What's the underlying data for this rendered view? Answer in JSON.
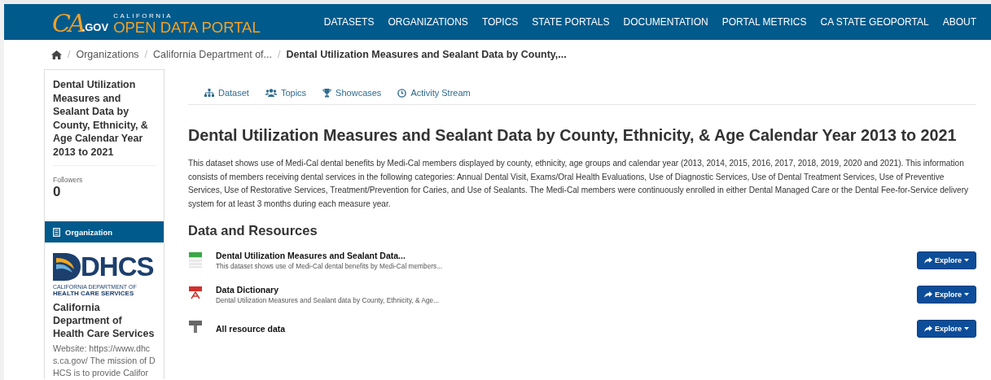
{
  "header": {
    "logo": {
      "mark": "CA",
      "gov": ".GOV",
      "top": "CALIFORNIA",
      "name": "OPEN DATA PORTAL"
    },
    "nav": [
      "DATASETS",
      "ORGANIZATIONS",
      "TOPICS",
      "STATE PORTALS",
      "DOCUMENTATION",
      "PORTAL METRICS",
      "CA STATE GEOPORTAL",
      "ABOUT"
    ]
  },
  "breadcrumb_separator": "/",
  "breadcrumb": [
    {
      "label": "Organizations",
      "current": false
    },
    {
      "label": "California Department of...",
      "current": false
    },
    {
      "label": "Dental Utilization Measures and Sealant Data by County,...",
      "current": true
    }
  ],
  "sidebar": {
    "title": "Dental Utilization Measures and Sealant Data by County, Ethnicity, & Age Calendar Year 2013 to 2021",
    "followers_label": "Followers",
    "followers": "0",
    "org_heading": "Organization",
    "org_logo": {
      "mark": "DHCS",
      "line1": "CALIFORNIA DEPARTMENT OF",
      "line2": "HEALTH CARE SERVICES"
    },
    "org_name": "California Department of Health Care Services",
    "org_text": "Website: https://www.dhcs.ca.gov/ The mission of DHCS is to provide Califor"
  },
  "tabs": [
    {
      "label": "Dataset",
      "kind": "sitemap"
    },
    {
      "label": "Topics",
      "kind": "users"
    },
    {
      "label": "Showcases",
      "kind": "trophy"
    },
    {
      "label": "Activity Stream",
      "kind": "clock"
    }
  ],
  "title": "Dental Utilization Measures and Sealant Data by County, Ethnicity, & Age Calendar Year 2013 to 2021",
  "description": "This dataset shows use of Medi-Cal dental benefits by Medi-Cal members displayed by county, ethnicity, age groups and calendar year (2013, 2014, 2015, 2016, 2017, 2018, 2019, 2020 and 2021). This information consists of members receiving dental services in the following categories: Annual Dental Visit, Exams/Oral Health Evaluations, Use of Diagnostic Services, Use of Dental Treatment Services, Use of Preventive Services, Use of Restorative Services, Treatment/Prevention for Caries, and Use of Sealants. The Medi-Cal members were continuously enrolled in either Dental Managed Care or the Dental Fee-for-Service delivery system for at least 3 months during each measure year.",
  "resources_heading": "Data and Resources",
  "resources": [
    {
      "kind": "csv",
      "name": "Dental Utilization Measures and Sealant Data...",
      "summary": "This dataset shows use of Medi-Cal dental benefits by Medi-Cal members...",
      "button": "Explore"
    },
    {
      "kind": "pdf",
      "name": "Data Dictionary",
      "summary": "Dental Utilization Measures and Sealant data by County, Ethnicity, & Age...",
      "button": "Explore"
    },
    {
      "kind": "zip",
      "name": "All resource data",
      "button": "Explore"
    }
  ]
}
